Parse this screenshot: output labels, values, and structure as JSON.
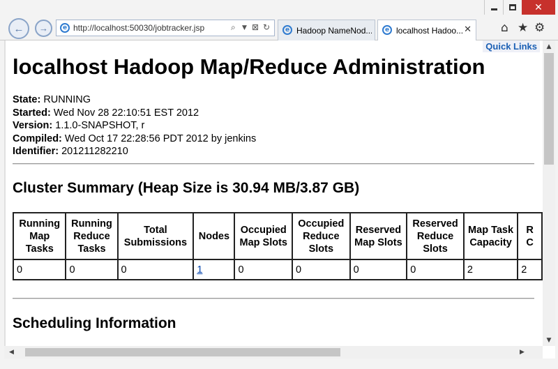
{
  "browser": {
    "url": "http://localhost:50030/jobtracker.jsp",
    "tabs": [
      {
        "title": "Hadoop NameNod..."
      },
      {
        "title": "localhost Hadoo..."
      }
    ],
    "icons": {
      "back": "back-arrow-icon",
      "forward": "forward-arrow-icon",
      "home": "home-icon",
      "favorites": "star-icon",
      "tools": "gear-icon"
    }
  },
  "page": {
    "quick_links": "Quick Links",
    "title": "localhost Hadoop Map/Reduce Administration",
    "info": [
      {
        "label": "State:",
        "value": "RUNNING"
      },
      {
        "label": "Started:",
        "value": "Wed Nov 28 22:10:51 EST 2012"
      },
      {
        "label": "Version:",
        "value": "1.1.0-SNAPSHOT, r"
      },
      {
        "label": "Compiled:",
        "value": "Wed Oct 17 22:28:56 PDT 2012 by jenkins"
      },
      {
        "label": "Identifier:",
        "value": "201211282210"
      }
    ],
    "cluster_summary_title": "Cluster Summary (Heap Size is 30.94 MB/3.87 GB)",
    "cluster_table": {
      "headers": [
        "Running Map Tasks",
        "Running Reduce Tasks",
        "Total Submissions",
        "Nodes",
        "Occupied Map Slots",
        "Occupied Reduce Slots",
        "Reserved Map Slots",
        "Reserved Reduce Slots",
        "Map Task Capacity",
        "R C"
      ],
      "row": [
        "0",
        "0",
        "0",
        "1",
        "0",
        "0",
        "0",
        "0",
        "2",
        "2"
      ]
    },
    "scheduling_title": "Scheduling Information"
  }
}
